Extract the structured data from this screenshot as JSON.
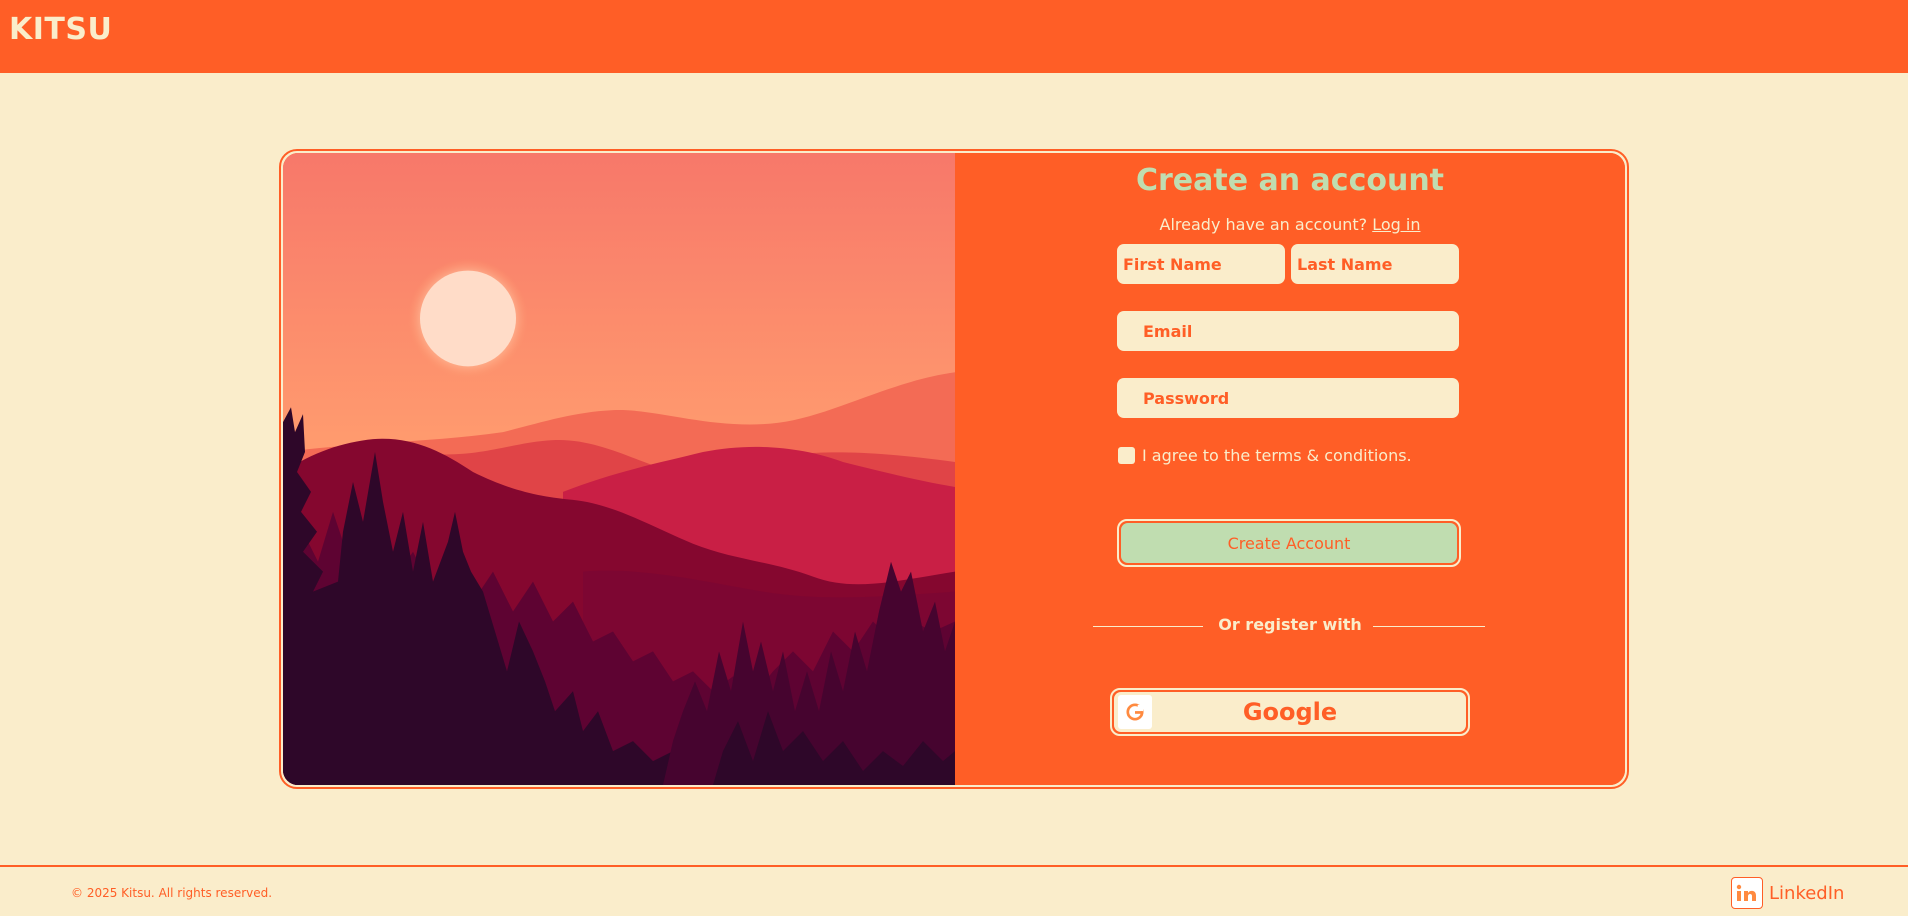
{
  "header": {
    "brand": "KITSU"
  },
  "form": {
    "title": "Create an account",
    "subtitle_prefix": "Already have an account?",
    "login_link": "Log in",
    "first_name_placeholder": "First Name",
    "last_name_placeholder": "Last Name",
    "email_placeholder": "Email",
    "password_placeholder": "Password",
    "terms_label": "I agree to the terms & conditions.",
    "create_button": "Create Account",
    "divider_text": "Or register with",
    "google_button": "Google"
  },
  "footer": {
    "copyright": "© 2025 Kitsu. All rights reserved.",
    "linkedin": "LinkedIn"
  },
  "colors": {
    "primary": "#FF5E26",
    "cream": "#FAEDCB",
    "mint": "#C0DDB0"
  },
  "icons": {
    "google": "google-icon",
    "linkedin": "linkedin-icon"
  }
}
